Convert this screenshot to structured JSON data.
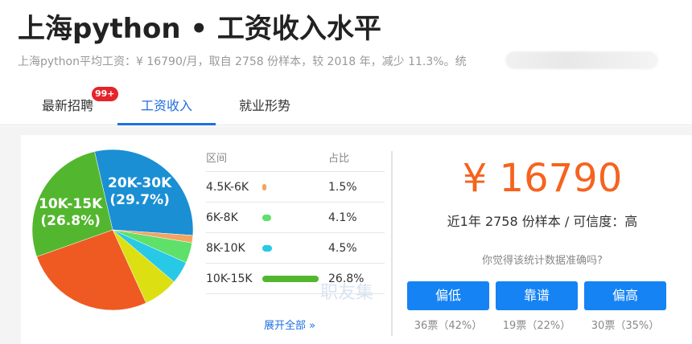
{
  "header": {
    "title": "上海python • 工资收入水平",
    "subtitle": "上海python平均工资：¥ 16790/月，取自 2758 份样本，较 2018 年，减少 11.3%。统"
  },
  "tabs": [
    {
      "label": "最新招聘",
      "badge": "99+"
    },
    {
      "label": "工资收入"
    },
    {
      "label": "就业形势"
    }
  ],
  "chart_data": {
    "type": "pie",
    "slices": [
      {
        "name": "20K-30K",
        "value": 29.7,
        "color": "#1a8fd4",
        "label": "20K-30K\n(29.7%)"
      },
      {
        "name": "4.5K-6K",
        "value": 1.5,
        "color": "#f4a460"
      },
      {
        "name": "6K-8K",
        "value": 4.1,
        "color": "#5ee06a"
      },
      {
        "name": "8K-10K",
        "value": 4.5,
        "color": "#27c9e6"
      },
      {
        "name": "other-yellow",
        "value": 7.0,
        "color": "#dce012"
      },
      {
        "name": "other-orange",
        "value": 26.4,
        "color": "#ee5a21"
      },
      {
        "name": "10K-15K",
        "value": 26.8,
        "color": "#53b62f",
        "label": "10K-15K\n(26.8%)"
      }
    ]
  },
  "pie_labels": {
    "s2030_range": "20K-30K",
    "s2030_pct": "(29.7%)",
    "s1015_range": "10K-15K",
    "s1015_pct": "(26.8%)"
  },
  "table": {
    "header_range": "区间",
    "header_pct": "占比",
    "rows": [
      {
        "range": "4.5K-6K",
        "pct": "1.5%",
        "value": 1.5,
        "color": "#f4a460"
      },
      {
        "range": "6K-8K",
        "pct": "4.1%",
        "value": 4.1,
        "color": "#5ee06a"
      },
      {
        "range": "8K-10K",
        "pct": "4.5%",
        "value": 4.5,
        "color": "#27c9e6"
      },
      {
        "range": "10K-15K",
        "pct": "26.8%",
        "value": 26.8,
        "color": "#53b62f"
      }
    ],
    "expand_label": "展开全部 »"
  },
  "watermark": "职友集",
  "summary": {
    "avg_salary": "¥ 16790",
    "sample_line": "近1年 2758 份样本 / 可信度：高",
    "question": "你觉得该统计数据准确吗?",
    "votes": [
      {
        "label": "偏低",
        "count": "36票（42%）"
      },
      {
        "label": "靠谱",
        "count": "19票（22%）"
      },
      {
        "label": "偏高",
        "count": "30票（35%）"
      }
    ]
  },
  "colors": {
    "accent": "#1f6fe0",
    "button": "#1583f4",
    "salary": "#f6631f",
    "badge": "#e6232a"
  }
}
